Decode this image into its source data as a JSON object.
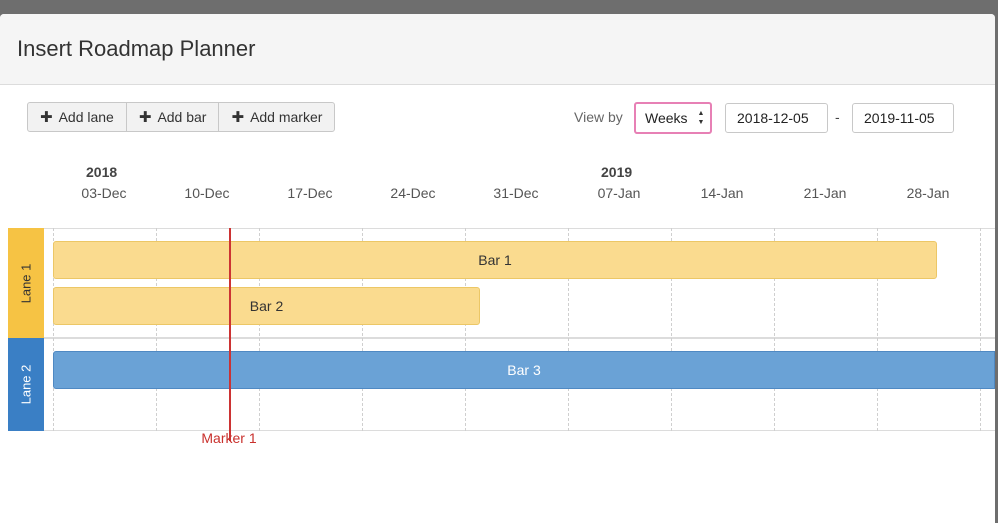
{
  "dialog": {
    "title": "Insert Roadmap Planner"
  },
  "toolbar": {
    "add_lane": "Add lane",
    "add_bar": "Add bar",
    "add_marker": "Add marker"
  },
  "view": {
    "label": "View by",
    "selected": "Weeks",
    "start_date": "2018-12-05",
    "separator": "-",
    "end_date": "2019-11-05"
  },
  "timeline": {
    "years": [
      "2018",
      "2019"
    ],
    "weeks": [
      "03-Dec",
      "10-Dec",
      "17-Dec",
      "24-Dec",
      "31-Dec",
      "07-Jan",
      "14-Jan",
      "21-Jan",
      "28-Jan"
    ]
  },
  "lanes": [
    {
      "name": "Lane 1",
      "color": "#f6c344"
    },
    {
      "name": "Lane 2",
      "color": "#3a7fc5"
    }
  ],
  "bars": [
    {
      "title": "Bar 1",
      "lane": 0
    },
    {
      "title": "Bar 2",
      "lane": 0
    },
    {
      "title": "Bar 3",
      "lane": 1
    }
  ],
  "markers": [
    {
      "title": "Marker 1",
      "color": "#cc3333"
    }
  ],
  "colors": {
    "select_highlight": "#e780b5",
    "bar_yellow": "#fadb8f",
    "bar_blue": "#6aa2d6"
  }
}
